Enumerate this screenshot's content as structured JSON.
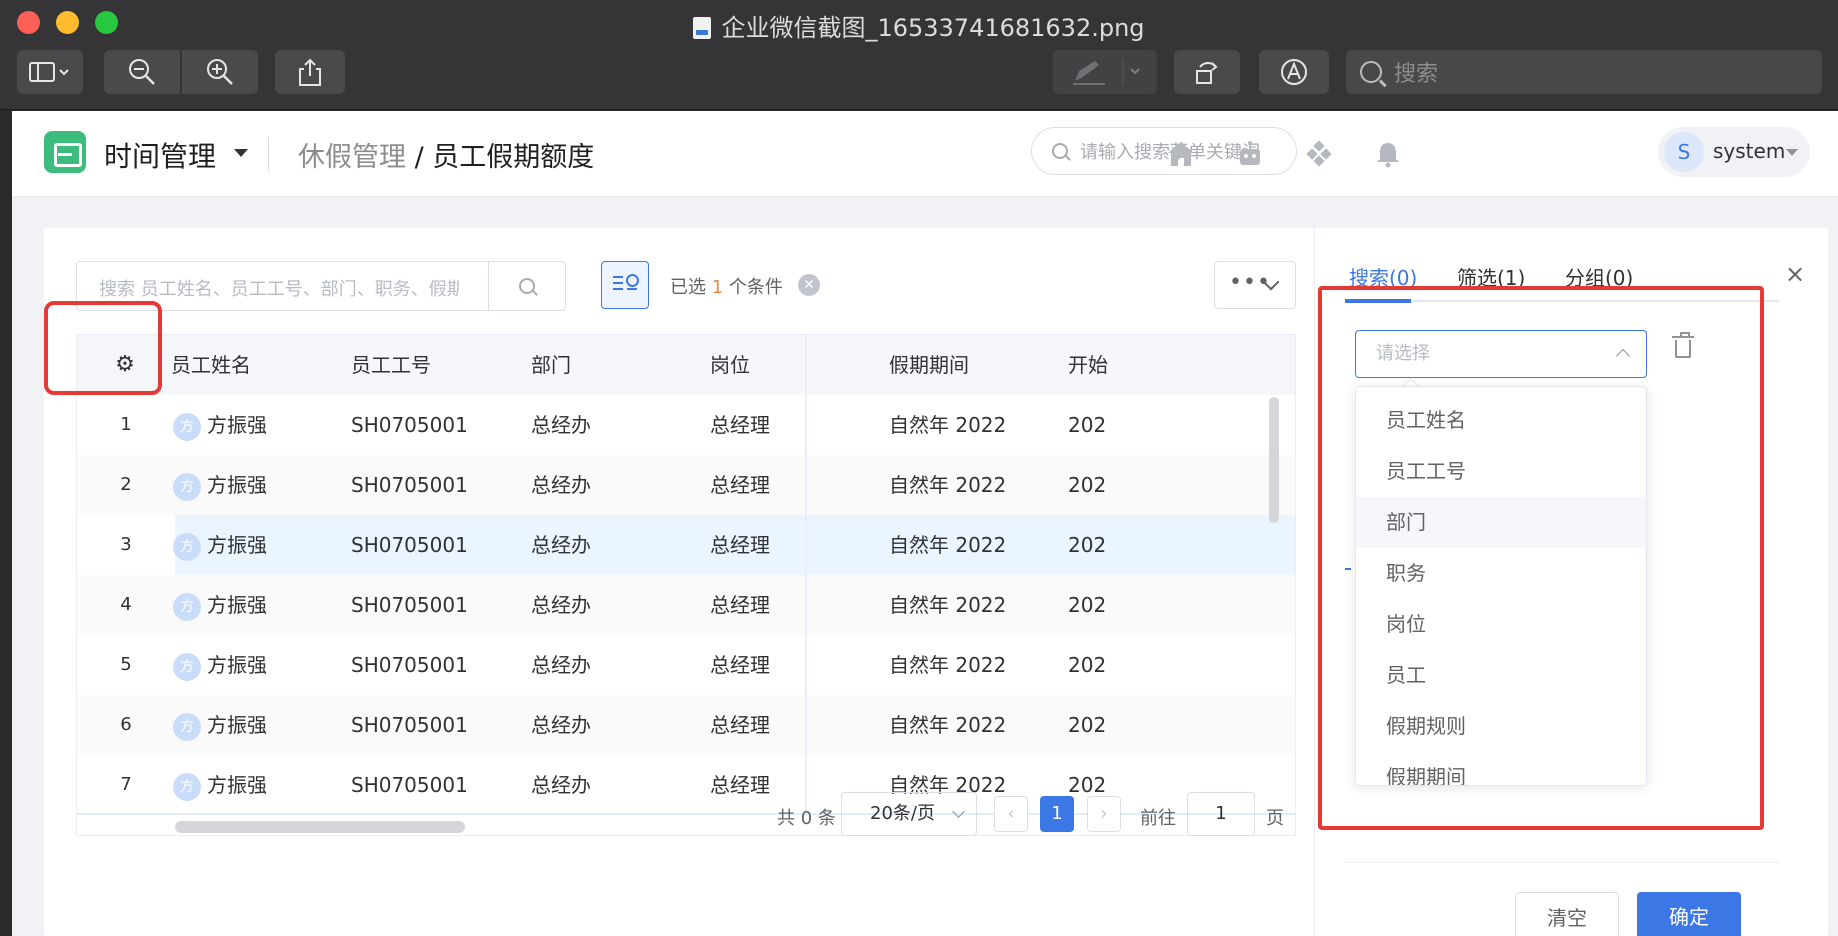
{
  "window": {
    "title": "企业微信截图_16533741681632.png",
    "search_placeholder": "搜索"
  },
  "header": {
    "app_name": "时间管理",
    "breadcrumb_parent": "休假管理",
    "breadcrumb_sep": " / ",
    "breadcrumb_current": "员工假期额度",
    "menu_search_placeholder": "请输入搜索菜单关键词",
    "user_initial": "S",
    "user_name": "system"
  },
  "toolbar": {
    "keyword_placeholder": "搜索 员工姓名、员工工号、部门、职务、假期",
    "cond_prefix": "已选",
    "cond_count": "1",
    "cond_suffix": "个条件",
    "more_label": "•••"
  },
  "table": {
    "columns": [
      "员工姓名",
      "员工工号",
      "部门",
      "岗位",
      "假期期间",
      "开始"
    ],
    "rows": [
      {
        "n": "1",
        "avatar": "方",
        "name": "方振强",
        "id": "SH0705001",
        "dept": "总经办",
        "post": "总经理",
        "period": "自然年 2022",
        "start": "202"
      },
      {
        "n": "2",
        "avatar": "方",
        "name": "方振强",
        "id": "SH0705001",
        "dept": "总经办",
        "post": "总经理",
        "period": "自然年 2022",
        "start": "202"
      },
      {
        "n": "3",
        "avatar": "方",
        "name": "方振强",
        "id": "SH0705001",
        "dept": "总经办",
        "post": "总经理",
        "period": "自然年 2022",
        "start": "202"
      },
      {
        "n": "4",
        "avatar": "方",
        "name": "方振强",
        "id": "SH0705001",
        "dept": "总经办",
        "post": "总经理",
        "period": "自然年 2022",
        "start": "202"
      },
      {
        "n": "5",
        "avatar": "方",
        "name": "方振强",
        "id": "SH0705001",
        "dept": "总经办",
        "post": "总经理",
        "period": "自然年 2022",
        "start": "202"
      },
      {
        "n": "6",
        "avatar": "方",
        "name": "方振强",
        "id": "SH0705001",
        "dept": "总经办",
        "post": "总经理",
        "period": "自然年 2022",
        "start": "202"
      },
      {
        "n": "7",
        "avatar": "方",
        "name": "方振强",
        "id": "SH0705001",
        "dept": "总经办",
        "post": "总经理",
        "period": "自然年 2022",
        "start": "202"
      }
    ]
  },
  "pagination": {
    "total": "共 0 条",
    "page_size": "20条/页",
    "prev": "‹",
    "current": "1",
    "next": "›",
    "goto_label": "前往",
    "goto_value": "1",
    "page_label": "页"
  },
  "panel": {
    "tabs": [
      "搜索(0)",
      "筛选(1)",
      "分组(0)"
    ],
    "close": "×",
    "select_placeholder": "请选择",
    "options": [
      "员工姓名",
      "员工工号",
      "部门",
      "职务",
      "岗位",
      "员工",
      "假期规则",
      "假期期间"
    ],
    "clear_label": "清空",
    "confirm_label": "确定"
  },
  "colors": {
    "accent": "#3c77e6",
    "annotation": "#e53935",
    "logo": "#3dbd7d"
  }
}
